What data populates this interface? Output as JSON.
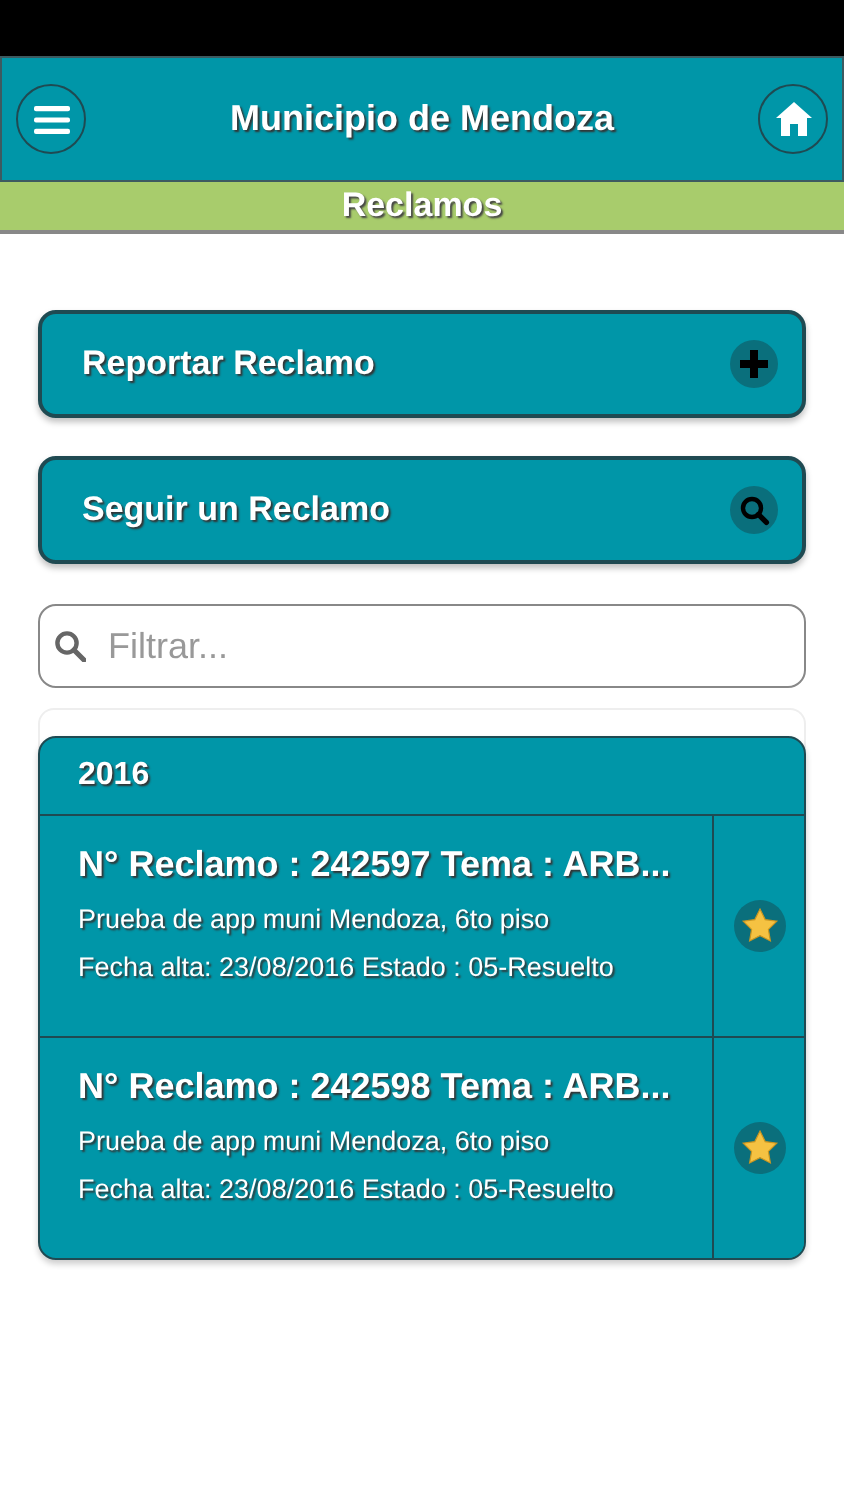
{
  "header": {
    "title": "Municipio de Mendoza"
  },
  "section": {
    "title": "Reclamos"
  },
  "actions": [
    {
      "label": "Reportar Reclamo",
      "kind": "add"
    },
    {
      "label": "Seguir un Reclamo",
      "kind": "search"
    }
  ],
  "filter": {
    "placeholder": "Filtrar..."
  },
  "group": {
    "title": "2016",
    "items": [
      {
        "title": "N° Reclamo : 242597 Tema : ARB...",
        "description": "Prueba de app muni Mendoza, 6to piso",
        "meta": "Fecha alta: 23/08/2016 Estado : 05-Resuelto"
      },
      {
        "title": "N° Reclamo : 242598 Tema : ARB...",
        "description": "Prueba de app muni Mendoza, 6to piso",
        "meta": "Fecha alta: 23/08/2016 Estado : 05-Resuelto"
      }
    ]
  }
}
